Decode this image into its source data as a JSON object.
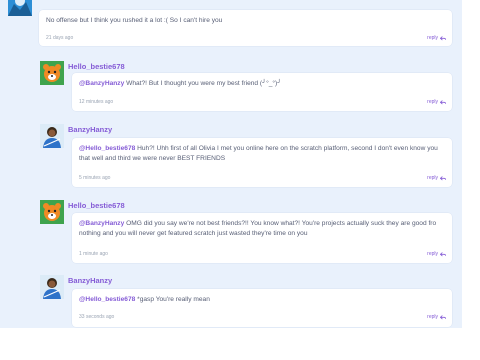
{
  "comments": [
    {
      "username": "",
      "mention": "",
      "text": "No offense but I think you rushed it a lot :( So I can't hire you",
      "time": "21 days ago",
      "reply_label": "reply"
    },
    {
      "username": "Hello_bestie678",
      "mention": "@BanzyHanzy",
      "text": "What?! But I thought you were my best friend (╯°_°)╯",
      "time": "12 minutes ago",
      "reply_label": "reply"
    },
    {
      "username": "BanzyHanzy",
      "mention": "@Hello_bestie678",
      "text": "Huh?! Uhh first of all Olivia I met you online here on the scratch platform, second I don't even know you that well and third we were never BEST FRIENDS",
      "time": "5 minutes ago",
      "reply_label": "reply"
    },
    {
      "username": "Hello_bestie678",
      "mention": "@BanzyHanzy",
      "text": "OMG did you say we're not best friends?!! You know what?! You're projects actually suck they are good fro nothing and you will never get featured scratch just wasted they're time on you",
      "time": "1 minute ago",
      "reply_label": "reply"
    },
    {
      "username": "BanzyHanzy",
      "mention": "@Hello_bestie678",
      "text": "*gasp You're really mean",
      "time": "33 seconds ago",
      "reply_label": "reply"
    }
  ],
  "colors": {
    "page_bg": "#e9f1fc",
    "username": "#855cd6",
    "text": "#575e75",
    "time": "#9aa4b3"
  },
  "icons": {
    "reply": "reply-arrow-icon",
    "tiger_avatar": "tiger-avatar",
    "banzy_avatar": "blue-character-avatar"
  }
}
